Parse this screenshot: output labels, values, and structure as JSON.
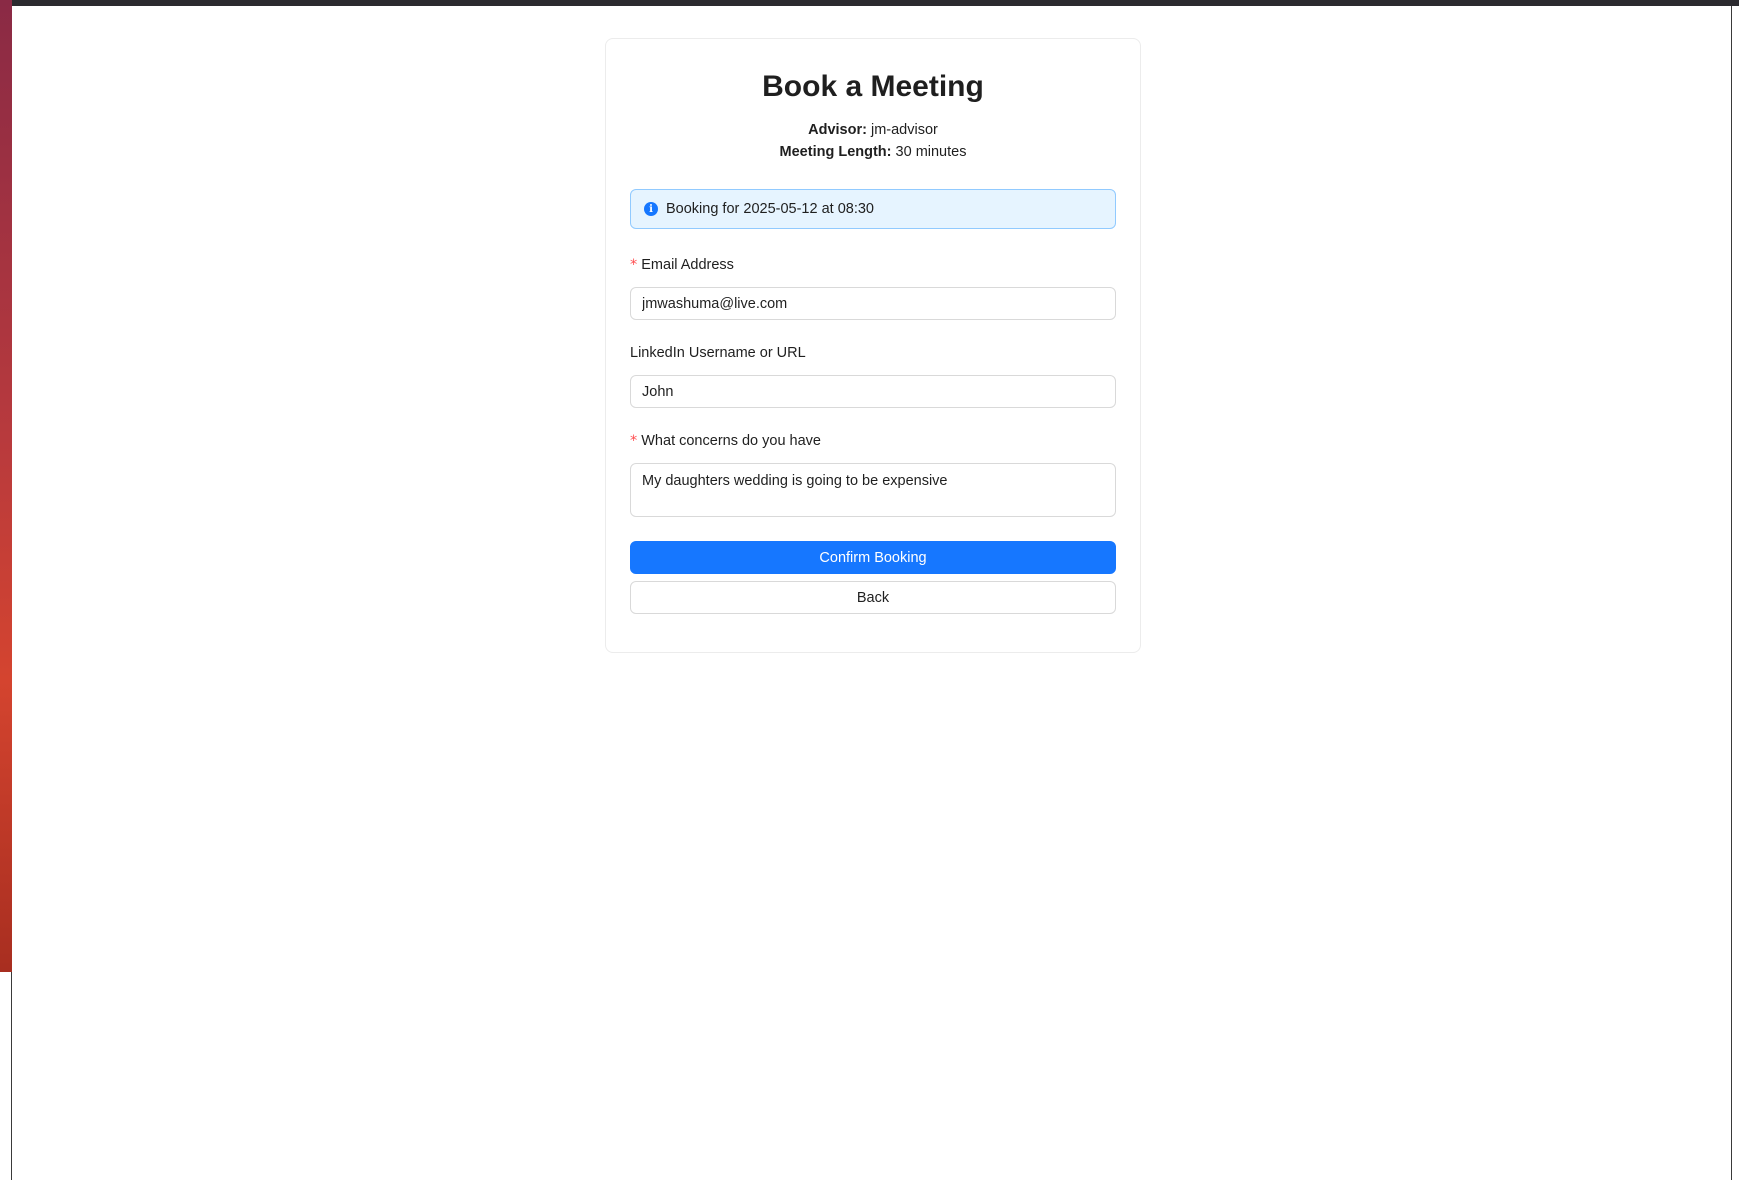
{
  "page": {
    "title": "Book a Meeting",
    "advisor_label": "Advisor:",
    "advisor_value": "jm-advisor",
    "length_label": "Meeting Length:",
    "length_value": "30 minutes"
  },
  "alert": {
    "icon": "info-icon",
    "text": "Booking for 2025-05-12 at 08:30"
  },
  "form": {
    "email": {
      "label": "Email Address",
      "required": true,
      "value": "jmwashuma@live.com"
    },
    "linkedin": {
      "label": "LinkedIn Username or URL",
      "required": false,
      "value": "John"
    },
    "concerns": {
      "label": "What concerns do you have",
      "required": true,
      "value": "My daughters wedding is going to be expensive"
    },
    "required_mark": "*"
  },
  "buttons": {
    "confirm": "Confirm Booking",
    "back": "Back"
  },
  "colors": {
    "primary": "#1677ff",
    "alert_bg": "#e6f4ff",
    "alert_border": "#91caff",
    "required": "#ff4d4f"
  }
}
